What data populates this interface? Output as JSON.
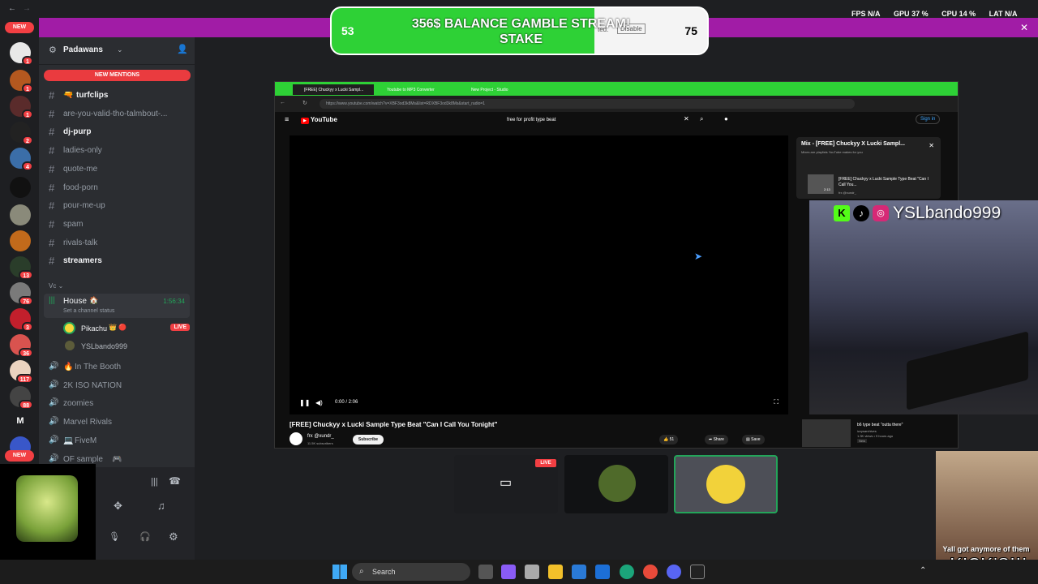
{
  "overlay": {
    "left_count": "53",
    "right_count": "75",
    "title": "356$ BALANCE GAMBLE STREAM! STAKE",
    "progress": 0.7,
    "fill_color": "#2ed136",
    "status_text": "ted.",
    "disable_label": "Disable"
  },
  "topbar": {
    "color": "#a11ca6",
    "fps_label": "FPS",
    "fps_value": "N/A",
    "gpu_label": "GPU",
    "gpu_value": "37 %",
    "cpu_label": "CPU",
    "cpu_value": "14 %",
    "lat_label": "LAT",
    "lat_value": "N/A"
  },
  "rail": {
    "new_label": "NEW",
    "new_label_2": "NEW",
    "badges": [
      "1",
      "1",
      "1",
      "2",
      "4",
      "13",
      "76",
      "3",
      "36",
      "117",
      "88"
    ],
    "letter_server": "M"
  },
  "server": {
    "name": "Padawans",
    "new_mentions": "NEW MENTIONS"
  },
  "channels": [
    {
      "name": "turfclips",
      "unread": true,
      "emoji": "🔫"
    },
    {
      "name": "are-you-valid-tho-talmbout-...",
      "unread": false,
      "emoji": ""
    },
    {
      "name": "dj-purp",
      "unread": true,
      "emoji": ""
    },
    {
      "name": "ladies-only",
      "unread": false,
      "emoji": "💗"
    },
    {
      "name": "quote-me",
      "unread": false,
      "emoji": ""
    },
    {
      "name": "food-porn",
      "unread": false,
      "emoji": ""
    },
    {
      "name": "pour-me-up",
      "unread": false,
      "emoji": ""
    },
    {
      "name": "spam",
      "unread": false,
      "emoji": ""
    },
    {
      "name": "rivals-talk",
      "unread": false,
      "emoji": ""
    },
    {
      "name": "streamers",
      "unread": true,
      "emoji": ""
    }
  ],
  "vc_category": "Vc",
  "voice": {
    "active_channel": "House",
    "active_emoji": "🏠",
    "timer": "1:56:34",
    "status_placeholder": "Set a channel status",
    "members": [
      {
        "name": "Pikachu",
        "emoji": "👑 🔴",
        "live": "LIVE"
      },
      {
        "name": "YSLbando999",
        "emoji": "",
        "live": ""
      }
    ],
    "other_channels": [
      {
        "name": "In The Booth",
        "emoji": "🔥"
      },
      {
        "name": "2K ISO NATION",
        "emoji": ""
      },
      {
        "name": "zoomies",
        "emoji": ""
      },
      {
        "name": "Marvel Rivals",
        "emoji": ""
      },
      {
        "name": "FiveM",
        "emoji": "💻"
      },
      {
        "name": "OF sample",
        "emoji": "🎮"
      }
    ]
  },
  "stream": {
    "tabs": [
      "[FREE] Chuckyy x Lucki Sampl...",
      "Youtube to MP3 Converter",
      "New Project - Studio"
    ],
    "url": "https://www.youtube.com/watch?v=XBF3od3k8Ms&list=RDXBF3od3k8Ms&start_radio=1",
    "yt_logo": "YouTube",
    "search_query": "free for profit type beat",
    "sign_in": "Sign in",
    "time": "0:00 / 2:06",
    "video_title": "[FREE] Chuckyy x Lucki Sample Type Beat \"Can I Call You Tonight\"",
    "channel": "frx @xundr_",
    "subs": "11.5K subscribers",
    "subscribe": "Subscribe",
    "likes": "51",
    "share": "Share",
    "save": "Save",
    "mix_title": "Mix - [FREE] Chuckyy X Lucki Sampl...",
    "mix_sub": "Mixes are playlists YouTube makes for you",
    "mix_item": "[FREE] Chuckyy x Lucki Sample Type Beat \"Can I Call You...",
    "mix_item_channel": "frx @xundr_",
    "mix_item_duration": "2:13",
    "rec_title": "b6 type beat \"outta there\"",
    "rec_channel": "izzysarchives",
    "rec_meta": "1.3K views • 9 hours ago",
    "rec_tag": "New"
  },
  "webcam": {
    "name": "YSLbando999"
  },
  "participants": {
    "live": "LIVE"
  },
  "taskbar": {
    "search": "Search"
  },
  "meme": {
    "caption": "Yall got anymore of them",
    "kicks": "KICK'S!!!"
  }
}
